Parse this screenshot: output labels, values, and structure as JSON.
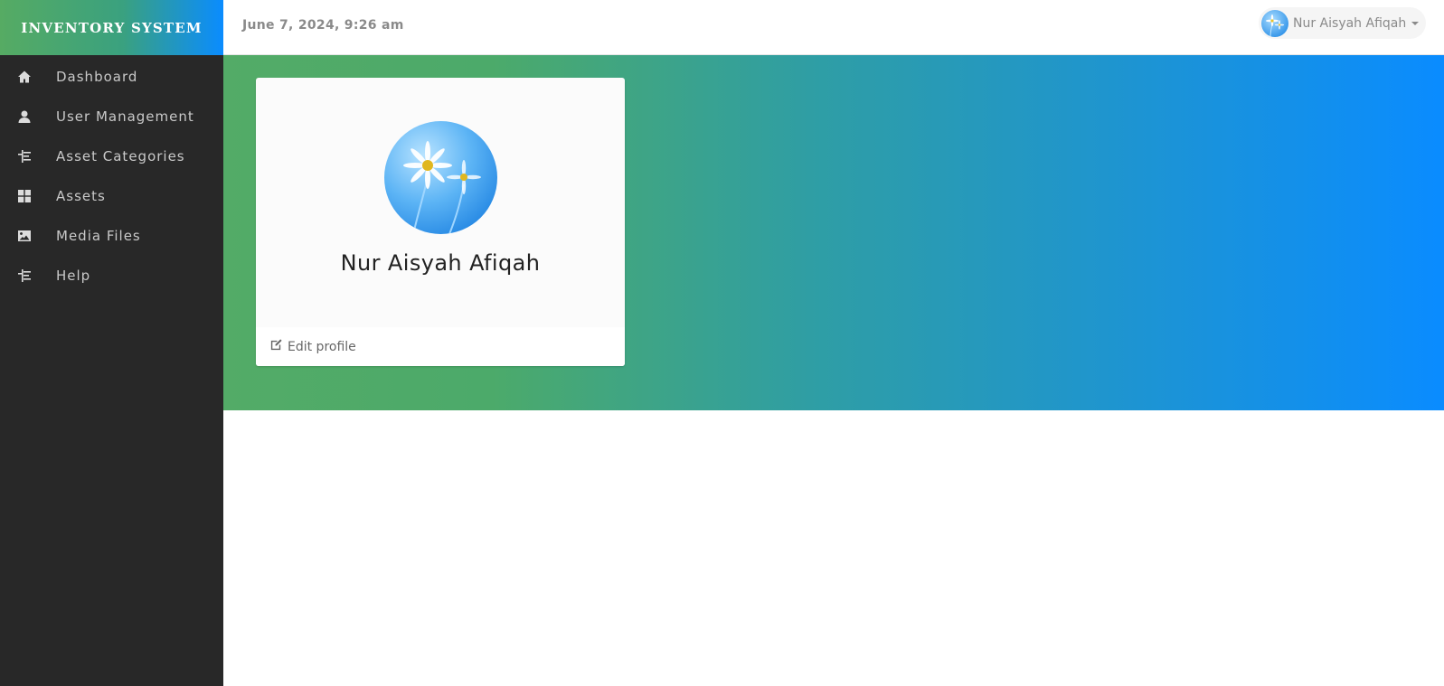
{
  "brand": {
    "title": "INVENTORY SYSTEM"
  },
  "sidebar": {
    "items": [
      {
        "label": "Dashboard",
        "icon": "home-icon"
      },
      {
        "label": "User Management",
        "icon": "user-icon"
      },
      {
        "label": "Asset Categories",
        "icon": "categories-icon"
      },
      {
        "label": "Assets",
        "icon": "grid-icon"
      },
      {
        "label": "Media Files",
        "icon": "image-icon"
      },
      {
        "label": "Help",
        "icon": "help-icon"
      }
    ]
  },
  "header": {
    "datetime": "June 7, 2024, 9:26 am",
    "user_name": "Nur Aisyah Afiqah"
  },
  "profile": {
    "name": "Nur Aisyah Afiqah",
    "edit_label": "Edit profile"
  },
  "colors": {
    "sidebar_bg": "#282828",
    "gradient_start": "#56ab63",
    "gradient_end": "#0a8cff"
  }
}
